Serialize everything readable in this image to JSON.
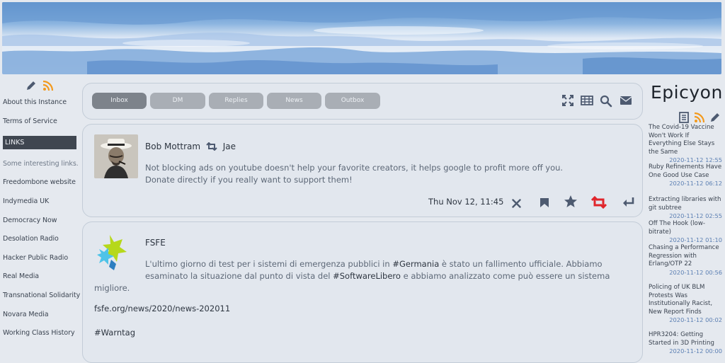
{
  "left": {
    "links": [
      "About this Instance",
      "Terms of Service"
    ],
    "links_header": "LINKS",
    "links_subtitle": "Some interesting links.",
    "link_items": [
      "Freedombone website",
      "Indymedia UK",
      "Democracy Now",
      "Desolation Radio",
      "Hacker Public Radio",
      "Real Media",
      "Transnational Solidarity",
      "Novara Media",
      "Working Class History"
    ]
  },
  "tabs": [
    "Inbox",
    "DM",
    "Replies",
    "News",
    "Outbox"
  ],
  "posts": [
    {
      "author": "Bob Mottram",
      "boosted_by": "Jae",
      "text_1": "Not blocking ads on youtube doesn't help your favorite creators, it helps google to profit more off you.",
      "text_2": "Donate directly if you really want to support them!",
      "date": "Thu Nov 12, 11:45"
    },
    {
      "author": "FSFE",
      "line1_a": "L'ultimo giorno di test per i sistemi di emergenza pubblici in ",
      "line1_tag": "#Germania",
      "line1_b": " è stato un fallimento ufficiale. Abbiamo",
      "line2_a": "esaminato la situazione dal punto di vista del ",
      "line2_tag": "#SoftwareLibero",
      "line2_b": " e abbiamo analizzato come può essere un sistema",
      "line3": "migliore.",
      "link": "fsfe.org/news/2020/news-202011",
      "tag": "#Warntag"
    }
  ],
  "right": {
    "title": "Epicyon",
    "news": [
      {
        "title": "The Covid-19 Vaccine Won't Work If Everything Else Stays the Same",
        "date": "2020-11-12 12:55"
      },
      {
        "title": "Ruby Refinements Have One Good Use Case",
        "date": "2020-11-12 06:12"
      },
      {
        "title": "Extracting libraries with git subtree",
        "date": "2020-11-12 02:55"
      },
      {
        "title": "Off The Hook (low-bitrate)",
        "date": "2020-11-12 01:10"
      },
      {
        "title": "Chasing a Performance Regression with Erlang/OTP 22",
        "date": "2020-11-12 00:56"
      },
      {
        "title": "Policing of UK BLM Protests Was Institutionally Racist, New Report Finds",
        "date": "2020-11-12 00:02"
      },
      {
        "title": "HPR3204: Getting Started in 3D Printing",
        "date": "2020-11-12 00:00"
      }
    ]
  },
  "colors": {
    "accent_red": "#e0262c",
    "rss_orange": "#f39a1e",
    "icon_blue": "#4d5a70"
  },
  "icons": [
    "pencil-icon",
    "rss-icon",
    "fullscreen-icon",
    "calendar-icon",
    "search-icon",
    "mail-icon",
    "boost-icon",
    "close-icon",
    "bookmark-icon",
    "star-icon",
    "reply-icon",
    "newswire-icon"
  ]
}
